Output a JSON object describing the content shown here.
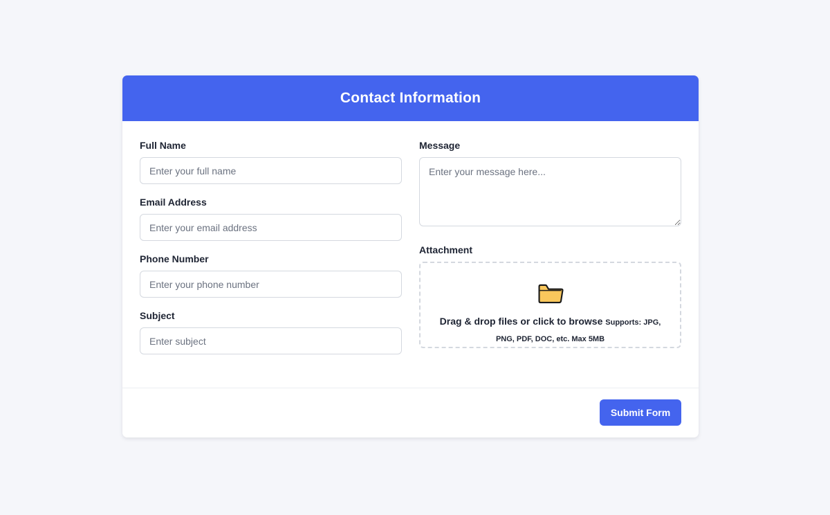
{
  "form": {
    "title": "Contact Information",
    "fields": {
      "full_name": {
        "label": "Full Name",
        "placeholder": "Enter your full name",
        "value": ""
      },
      "email": {
        "label": "Email Address",
        "placeholder": "Enter your email address",
        "value": ""
      },
      "phone": {
        "label": "Phone Number",
        "placeholder": "Enter your phone number",
        "value": ""
      },
      "subject": {
        "label": "Subject",
        "placeholder": "Enter subject",
        "value": ""
      },
      "message": {
        "label": "Message",
        "placeholder": "Enter your message here...",
        "value": ""
      }
    },
    "attachment": {
      "label": "Attachment",
      "icon": "folder-icon",
      "main_text": "Drag & drop files or click to browse",
      "sub_text": "Supports: JPG, PNG, PDF, DOC, etc. Max 5MB"
    },
    "submit_label": "Submit Form"
  },
  "colors": {
    "accent": "#4464ee",
    "background": "#f5f6fa",
    "card": "#ffffff",
    "border": "#d4d8df",
    "text": "#1e2433",
    "placeholder": "#6b7280",
    "folder_fill": "#f9c75c"
  }
}
